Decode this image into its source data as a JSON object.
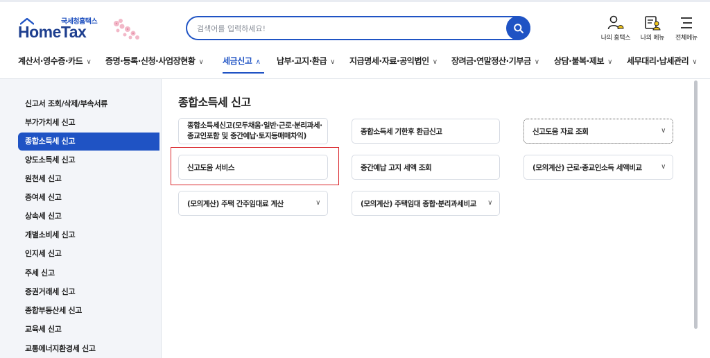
{
  "header": {
    "logo_sub": "국세청홈택스",
    "logo_main": "HomeTax",
    "search_placeholder": "검색어를 입력하세요!",
    "icons": [
      {
        "name": "my-hometax-icon",
        "label": "나의 홈택스"
      },
      {
        "name": "my-menu-icon",
        "label": "나의 메뉴"
      },
      {
        "name": "all-menu-icon",
        "label": "전체메뉴"
      }
    ]
  },
  "gnb": [
    {
      "label": "계산서·영수증·카드",
      "chevron": "∨"
    },
    {
      "label": "증명·등록·신청·사업장현황",
      "chevron": "∨"
    },
    {
      "label": "세금신고",
      "chevron": "∧",
      "active": true
    },
    {
      "label": "납부·고지·환급",
      "chevron": "∨"
    },
    {
      "label": "지급명세·자료·공익법인",
      "chevron": "∨"
    },
    {
      "label": "장려금·연말정산·기부금",
      "chevron": "∨"
    },
    {
      "label": "상담·불복·제보",
      "chevron": "∨"
    },
    {
      "label": "세무대리·납세관리",
      "chevron": "∨"
    }
  ],
  "sidebar": {
    "items": [
      {
        "label": "신고서 조회/삭제/부속서류"
      },
      {
        "label": "부가가치세 신고"
      },
      {
        "label": "종합소득세 신고",
        "active": true
      },
      {
        "label": "양도소득세 신고"
      },
      {
        "label": "원천세 신고"
      },
      {
        "label": "증여세 신고"
      },
      {
        "label": "상속세 신고"
      },
      {
        "label": "개별소비세 신고"
      },
      {
        "label": "인지세 신고"
      },
      {
        "label": "주세 신고"
      },
      {
        "label": "증권거래세 신고"
      },
      {
        "label": "종합부동산세 신고"
      },
      {
        "label": "교육세 신고"
      },
      {
        "label": "교통에너지환경세 신고"
      }
    ]
  },
  "main": {
    "title": "종합소득세 신고",
    "cards": [
      {
        "label": "종합소득세신고(모두채움·일반·근로·분리과세·종교인포함 및 중간예납·토지등매매차익)",
        "chevron": ""
      },
      {
        "label": "종합소득세 기한후 환급신고",
        "chevron": ""
      },
      {
        "label": "신고도움 자료 조회",
        "chevron": "∨"
      },
      {
        "label": "신고도움 서비스",
        "chevron": ""
      },
      {
        "label": "중간예납 고지 세액 조회",
        "chevron": ""
      },
      {
        "label": "(모의계산) 근로·종교인소득 세액비교",
        "chevron": "∨"
      },
      {
        "label": "(모의계산) 주택 간주임대료 계산",
        "chevron": "∨"
      },
      {
        "label": "(모의계산) 주택임대 종합·분리과세비교",
        "chevron": "∨"
      }
    ]
  },
  "colors": {
    "primary": "#1f53c4",
    "highlight_border": "#d9262b",
    "sidebar_bg": "#f3f5f9"
  }
}
